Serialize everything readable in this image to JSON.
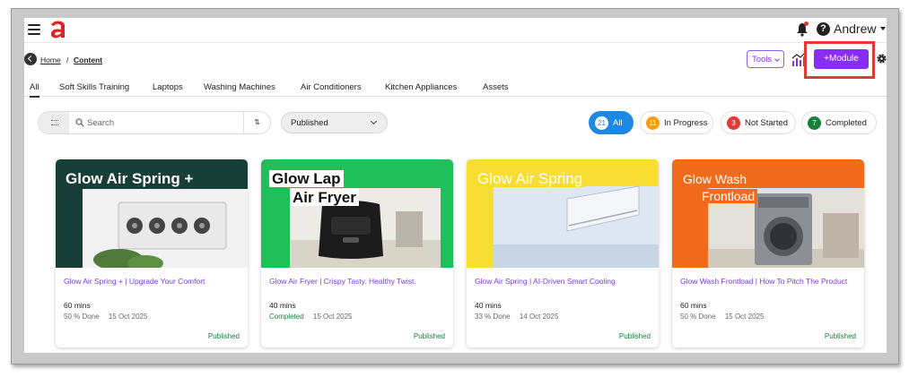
{
  "topbar": {
    "user_name": "Andrew"
  },
  "breadcrumb": {
    "home": "Home",
    "separator": "/",
    "current": "Content"
  },
  "toolbar": {
    "tools_label": "Tools",
    "module_label": "+Module"
  },
  "tabs": [
    {
      "label": "All",
      "active": true
    },
    {
      "label": "Soft Skills Training"
    },
    {
      "label": "Laptops"
    },
    {
      "label": "Washing Machines"
    },
    {
      "label": "Air Conditioners"
    },
    {
      "label": "Kitchen Appliances"
    },
    {
      "label": "Assets"
    }
  ],
  "filters": {
    "search_placeholder": "Search",
    "sort_icon": "sort-arrows-icon",
    "status_selected": "Published",
    "pills": [
      {
        "count": "21",
        "label": "All",
        "color": "#1e88e5"
      },
      {
        "count": "11",
        "label": "In Progress",
        "color": "#f59e0b"
      },
      {
        "count": "3",
        "label": "Not Started",
        "color": "#e53935"
      },
      {
        "count": "7",
        "label": "Completed",
        "color": "#16803c"
      }
    ]
  },
  "cards": [
    {
      "image_headline": "Glow Air Spring +",
      "title": "Glow Air Spring + | Upgrade Your Comfort",
      "duration": "60 mins",
      "progress": "50 % Done",
      "date": "15 Oct 2025",
      "status": "Published"
    },
    {
      "image_headline_1": "Glow Lap",
      "image_headline_2": "Air Fryer",
      "title": "Glow Air Fryer | Crispy Tasty. Healthy Twist.",
      "duration": "40 mins",
      "progress": "Completed",
      "date": "15 Oct 2025",
      "status": "Published"
    },
    {
      "image_headline": "Glow Air Spring",
      "title": "Glow Air Spring | AI-Driven Smart Cooling",
      "duration": "40 mins",
      "progress": "33 % Done",
      "date": "14 Oct 2025",
      "status": "Published"
    },
    {
      "image_headline_1": "Glow Wash",
      "image_headline_2": "Frontload",
      "title": "Glow Wash Frontload | How To Pitch The Product",
      "duration": "60 mins",
      "progress": "50 % Done",
      "date": "15 Oct 2025",
      "status": "Published"
    }
  ],
  "colors": {
    "accent_purple": "#8b2cf5",
    "highlight_red": "#e53935",
    "status_green": "#16803c",
    "all_blue": "#1e88e5"
  }
}
